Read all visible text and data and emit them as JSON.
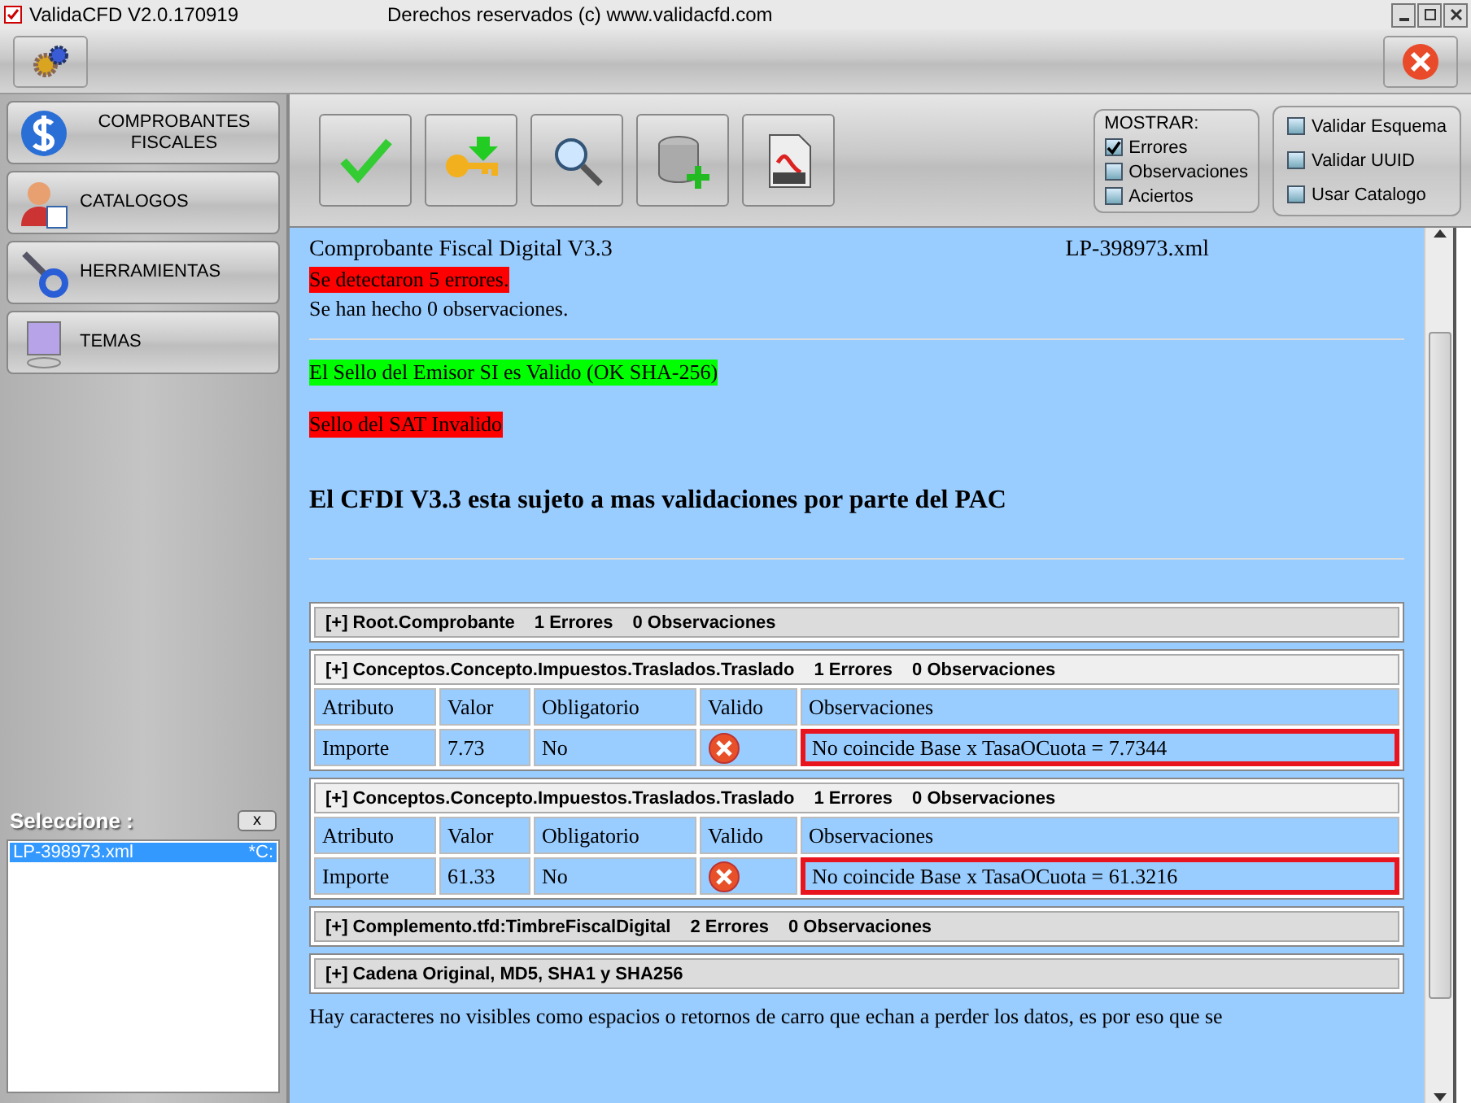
{
  "window": {
    "title": "ValidaCFD V2.0.170919",
    "subtitle": "Derechos reservados (c) www.validacfd.com"
  },
  "sidebar": {
    "items": [
      {
        "label": "COMPROBANTES FISCALES",
        "kind": "dollar"
      },
      {
        "label": "CATALOGOS",
        "kind": "person"
      },
      {
        "label": "HERRAMIENTAS",
        "kind": "tools"
      },
      {
        "label": "TEMAS",
        "kind": "monitor"
      }
    ],
    "select_label": "Seleccione :",
    "clear_button": "x",
    "files": [
      {
        "name": "LP-398973.xml",
        "path": "*C:",
        "selected": true
      }
    ]
  },
  "toolbar": {
    "buttons": [
      {
        "kind": "check"
      },
      {
        "kind": "key"
      },
      {
        "kind": "search"
      },
      {
        "kind": "database"
      },
      {
        "kind": "pdf"
      }
    ],
    "show": {
      "title": "MOSTRAR:",
      "options": [
        {
          "label": "Errores",
          "checked": true
        },
        {
          "label": "Observaciones",
          "checked": false
        },
        {
          "label": "Aciertos",
          "checked": false
        }
      ]
    },
    "validate": [
      {
        "label": "Validar Esquema",
        "checked": false
      },
      {
        "label": "Validar UUID",
        "checked": false
      },
      {
        "label": "Usar Catalogo",
        "checked": false
      }
    ]
  },
  "report": {
    "title": "Comprobante Fiscal Digital V3.3",
    "file": "LP-398973.xml",
    "summary": [
      {
        "text": "Se detectaron 5 errores.",
        "kind": "error"
      },
      {
        "text": "Se han hecho 0 observaciones.",
        "kind": "plain"
      }
    ],
    "seals": [
      {
        "text": "El Sello del Emisor SI es Valido (OK SHA-256)",
        "kind": "ok"
      },
      {
        "text": "Sello del SAT Invalido",
        "kind": "error"
      }
    ],
    "notice": "El CFDI V3.3 esta sujeto a mas validaciones por parte del PAC",
    "sections": [
      {
        "title": "[+] Root.Comprobante",
        "errors": "1 Errores",
        "observations": "0 Observaciones",
        "expanded": false
      },
      {
        "title": "[+] Conceptos.Concepto.Impuestos.Traslados.Traslado",
        "errors": "1 Errores",
        "observations": "0 Observaciones",
        "expanded": true,
        "columns": [
          "Atributo",
          "Valor",
          "Obligatorio",
          "Valido",
          "Observaciones"
        ],
        "rows": [
          {
            "attribute": "Importe",
            "value": "7.73",
            "required": "No",
            "valid": false,
            "note": "No coincide Base x TasaOCuota = 7.7344",
            "highlighted": true
          }
        ]
      },
      {
        "title": "[+] Conceptos.Concepto.Impuestos.Traslados.Traslado",
        "errors": "1 Errores",
        "observations": "0 Observaciones",
        "expanded": true,
        "columns": [
          "Atributo",
          "Valor",
          "Obligatorio",
          "Valido",
          "Observaciones"
        ],
        "rows": [
          {
            "attribute": "Importe",
            "value": "61.33",
            "required": "No",
            "valid": false,
            "note": "No coincide Base x TasaOCuota = 61.3216",
            "highlighted": true
          }
        ]
      },
      {
        "title": "[+] Complemento.tfd:TimbreFiscalDigital",
        "errors": "2 Errores",
        "observations": "0 Observaciones",
        "expanded": false
      },
      {
        "title": "[+] Cadena Original, MD5, SHA1 y SHA256",
        "expanded": false
      }
    ],
    "footer": "Hay caracteres no visibles como espacios o retornos de carro que echan a perder los datos, es por eso que se"
  }
}
